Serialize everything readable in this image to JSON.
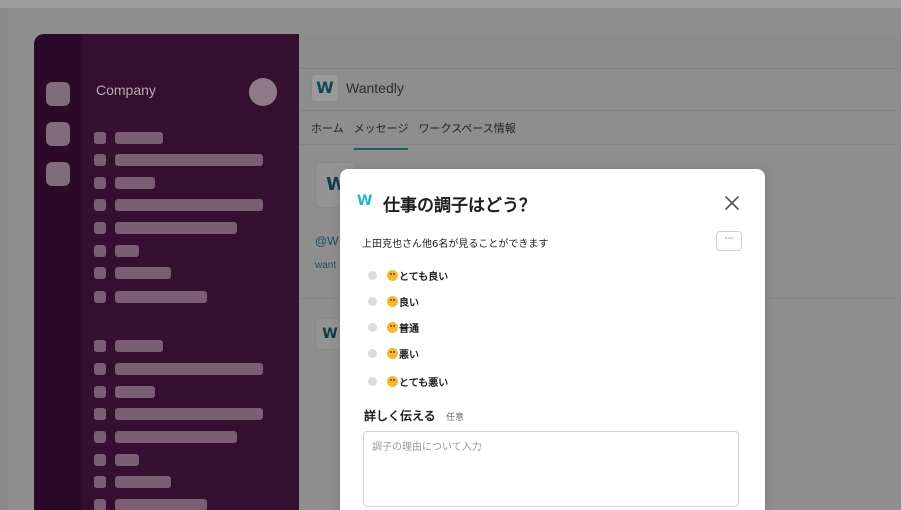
{
  "workspace": {
    "team_name": "Company"
  },
  "app": {
    "name": "Wantedly",
    "logo_glyph": "W",
    "tabs": [
      {
        "label": "ホーム",
        "active": false
      },
      {
        "label": "メッセージ",
        "active": true
      },
      {
        "label": "ワークスペース情報",
        "active": false
      }
    ],
    "background_snippets": {
      "mention": "@W",
      "link": "want"
    }
  },
  "modal": {
    "logo_glyph": "W",
    "title": "仕事の調子はどう？",
    "visibility_text": "上田克也さん他6名が見ることができます",
    "more_label": "···",
    "options": [
      {
        "emoji": "smile-emoji",
        "label": "とても良い"
      },
      {
        "emoji": "smile-emoji",
        "label": "良い"
      },
      {
        "emoji": "neutral-emoji",
        "label": "普通"
      },
      {
        "emoji": "thinking-emoji",
        "label": "悪い"
      },
      {
        "emoji": "sad-emoji",
        "label": "とても悪い"
      }
    ],
    "detail_label": "詳しく伝える",
    "detail_optional": "任意",
    "detail_placeholder": "調子の理由について入力"
  },
  "colors": {
    "sidebar": "#340f30",
    "accent": "#2ab4c8",
    "tab_underline": "#1f5d5f"
  }
}
